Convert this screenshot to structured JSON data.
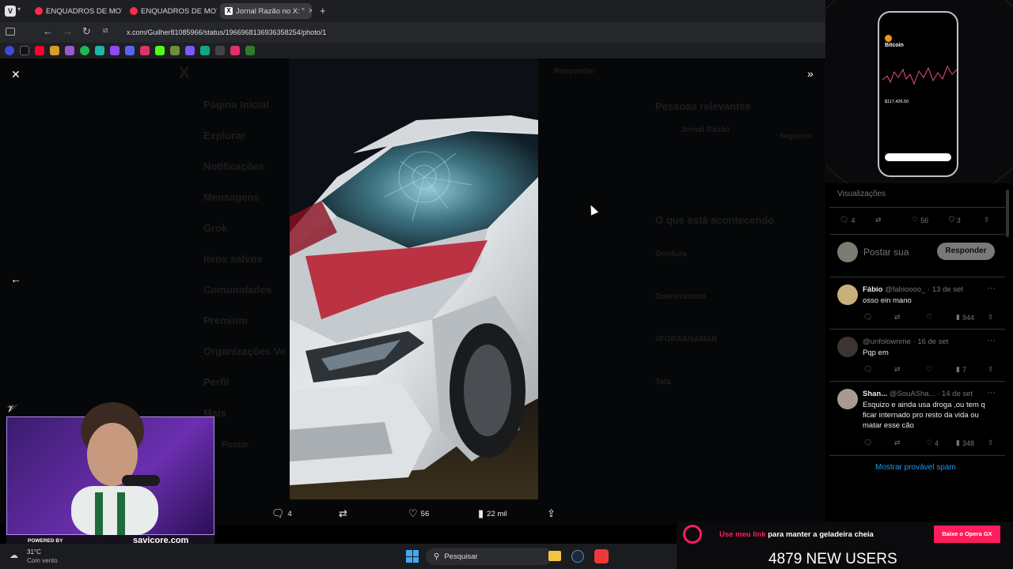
{
  "browser": {
    "tabs": [
      {
        "label": "ENQUADROS DE MOTO",
        "active": false
      },
      {
        "label": "ENQUADROS DE MOTO",
        "active": false
      },
      {
        "label": "Jornal Razão no X: \"",
        "active": true
      }
    ],
    "url": "x.com/Guilher81085966/status/1966968136936358254/photo/1"
  },
  "background_nav": {
    "items": [
      "Página Inicial",
      "Explorar",
      "Notificações",
      "Mensagens",
      "Grok",
      "Itens salvos",
      "Comunidades",
      "Premium",
      "Organizações Ve",
      "Perfil",
      "Mais",
      "Postar"
    ],
    "respond_label": "Responder",
    "relevant_title": "Pessoas relevantes",
    "relevant_name": "Jornal Razão",
    "relevant_follow": "Seguindo",
    "happening_title": "O que está acontecendo",
    "trends": [
      "Gordura",
      "Doenerumma",
      "#FORAANAMAR",
      "Tata"
    ]
  },
  "photo_viewer": {
    "action_bar": {
      "replies": "4",
      "reposts": "",
      "likes": "56",
      "views": "22 mil"
    }
  },
  "right_panel": {
    "views_label": "Visualizações",
    "stats": {
      "replies": "4",
      "likes": "56",
      "bookmarks": "3"
    },
    "compose_placeholder": "Postar sua",
    "respond_button": "Responder",
    "replies": [
      {
        "name": "Fábio",
        "handle": "@fabioooo_",
        "date": "· 13 de set",
        "text": "osso ein mano",
        "views": "944",
        "likes": ""
      },
      {
        "name": "",
        "handle": "@unfolownme",
        "date": "· 16 de set",
        "text": "Pqp em",
        "views": "7",
        "likes": ""
      },
      {
        "name": "Shan...",
        "handle": "@SouASha...",
        "date": "· 14 de set",
        "text": "Esquizo e ainda usa droga ,ou tem q ficar internado pro resto da vida ou matar esse cão",
        "views": "348",
        "likes": "4"
      }
    ],
    "spam_link": "Mostrar provável spam"
  },
  "phone_ad": {
    "coin": "Bitcoin",
    "price": "$117,426.50"
  },
  "webcam": {
    "powered_by": "POWERED BY",
    "brand": "savicore.com"
  },
  "taskbar": {
    "temp": "31°C",
    "weather": "Com vento",
    "search": "Pesquisar"
  },
  "promo": {
    "text_highlight": "Use meu link",
    "text_rest": " para manter a geladeira cheia",
    "button": "Baixe o Opera GX",
    "users": "4879 NEW USERS"
  },
  "colors": {
    "accent_blue": "#1d9bf0",
    "x_black": "#000000",
    "promo_pink": "#ff1d5e"
  }
}
